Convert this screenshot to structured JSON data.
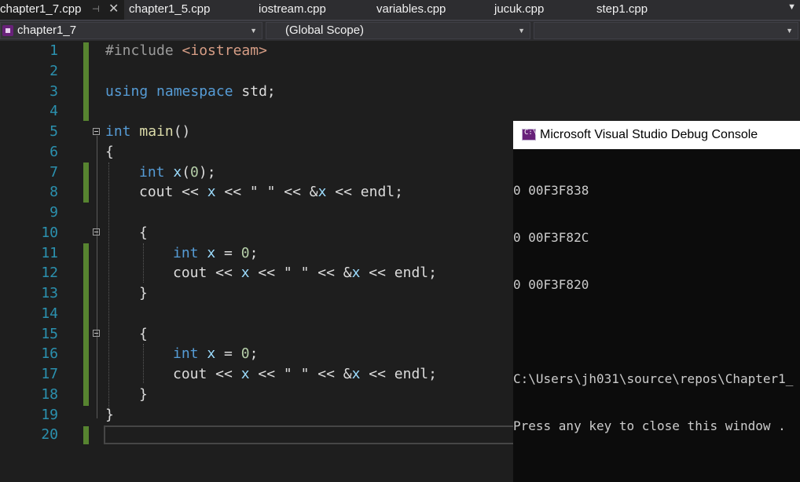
{
  "tabs": [
    {
      "label": "chapter1_7.cpp",
      "active": true
    },
    {
      "label": "chapter1_5.cpp"
    },
    {
      "label": "iostream.cpp"
    },
    {
      "label": "variables.cpp"
    },
    {
      "label": "jucuk.cpp"
    },
    {
      "label": "step1.cpp"
    }
  ],
  "tab_icons": {
    "pin": "pin-icon",
    "close": "close-icon",
    "overflow": "chevron-down-icon"
  },
  "navbar": {
    "project": "chapter1_7",
    "scope": "(Global Scope)",
    "member": ""
  },
  "editor": {
    "line_numbers": [
      "1",
      "2",
      "3",
      "4",
      "5",
      "6",
      "7",
      "8",
      "9",
      "10",
      "11",
      "12",
      "13",
      "14",
      "15",
      "16",
      "17",
      "18",
      "19",
      "20"
    ],
    "code": {
      "l1_directive": "#include",
      "l1_header": "<iostream>",
      "l3_using": "using",
      "l3_namespace": "namespace",
      "l3_rest": "std;",
      "l5_int": "int",
      "l5_main": "main",
      "l5_parens": "()",
      "l6": "{",
      "l7_int": "int",
      "l7_x": "x",
      "l7_open": "(",
      "l7_zero": "0",
      "l7_close": ");",
      "l8_cout": "cout << ",
      "l8_x": "x",
      "l8_mid": " << \" \" << &",
      "l8_x2": "x",
      "l8_end": " << endl;",
      "l10": "{",
      "l11_int": "int",
      "l11_x": "x",
      "l11_eq": " = ",
      "l11_zero": "0",
      "l11_semi": ";",
      "l12_cout": "cout << ",
      "l12_x": "x",
      "l12_mid": " << \" \" << &",
      "l12_x2": "x",
      "l12_end": " << endl;",
      "l13": "}",
      "l15": "{",
      "l16_int": "int",
      "l16_x": "x",
      "l16_eq": " = ",
      "l16_zero": "0",
      "l16_semi": ";",
      "l17_cout": "cout << ",
      "l17_x": "x",
      "l17_mid": " << \" \" << &",
      "l17_x2": "x",
      "l17_end": " << endl;",
      "l18": "}",
      "l19": "}"
    }
  },
  "console": {
    "title": "Microsoft Visual Studio Debug Console",
    "icon": "console-app-icon",
    "icon_text": "C:\\",
    "lines": [
      "0 00F3F838",
      "0 00F3F82C",
      "0 00F3F820",
      "",
      "C:\\Users\\jh031\\source\\repos\\Chapter1_",
      "Press any key to close this window ."
    ]
  },
  "colors": {
    "keyword": "#569cd6",
    "string": "#d69d85",
    "function": "#dcdcaa",
    "number": "#b5cea8",
    "line_number": "#2b91af",
    "change_bar": "#578430"
  }
}
